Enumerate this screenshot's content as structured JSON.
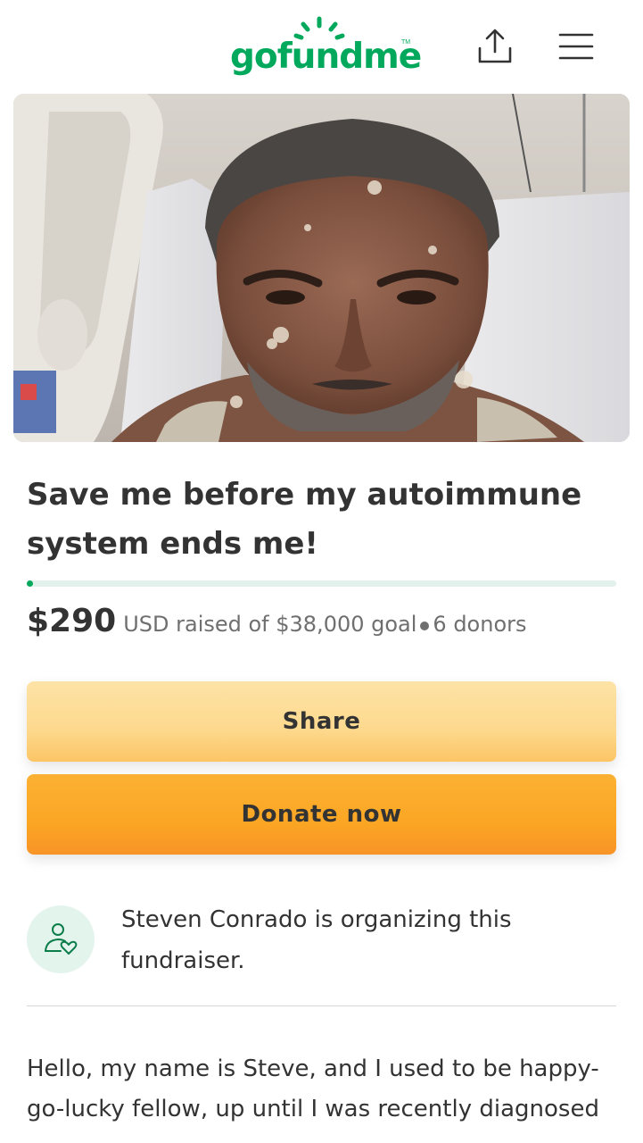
{
  "header": {
    "logo_text": "gofundme",
    "logo_tm": "TM",
    "brand_color": "#02a95c",
    "share_icon": "share-upload-icon",
    "menu_icon": "hamburger-menu-icon"
  },
  "campaign": {
    "title": "Save me before my autoimmune system ends me!",
    "raised_amount": "$290",
    "raised_detail": "USD raised of $38,000 goal",
    "donors": "6 donors",
    "progress_fraction": 0.0076
  },
  "buttons": {
    "share_label": "Share",
    "donate_label": "Donate now"
  },
  "organizer": {
    "icon": "person-heart-icon",
    "text": "Steven Conrado is organizing this fundraiser."
  },
  "story": {
    "text": "Hello, my name is Steve, and I used to be happy-go-lucky fellow, up until I was recently diagnosed"
  },
  "colors": {
    "share_button": "#fdd98e",
    "donate_button": "#fba624",
    "progress_track": "#e3f1ec"
  }
}
